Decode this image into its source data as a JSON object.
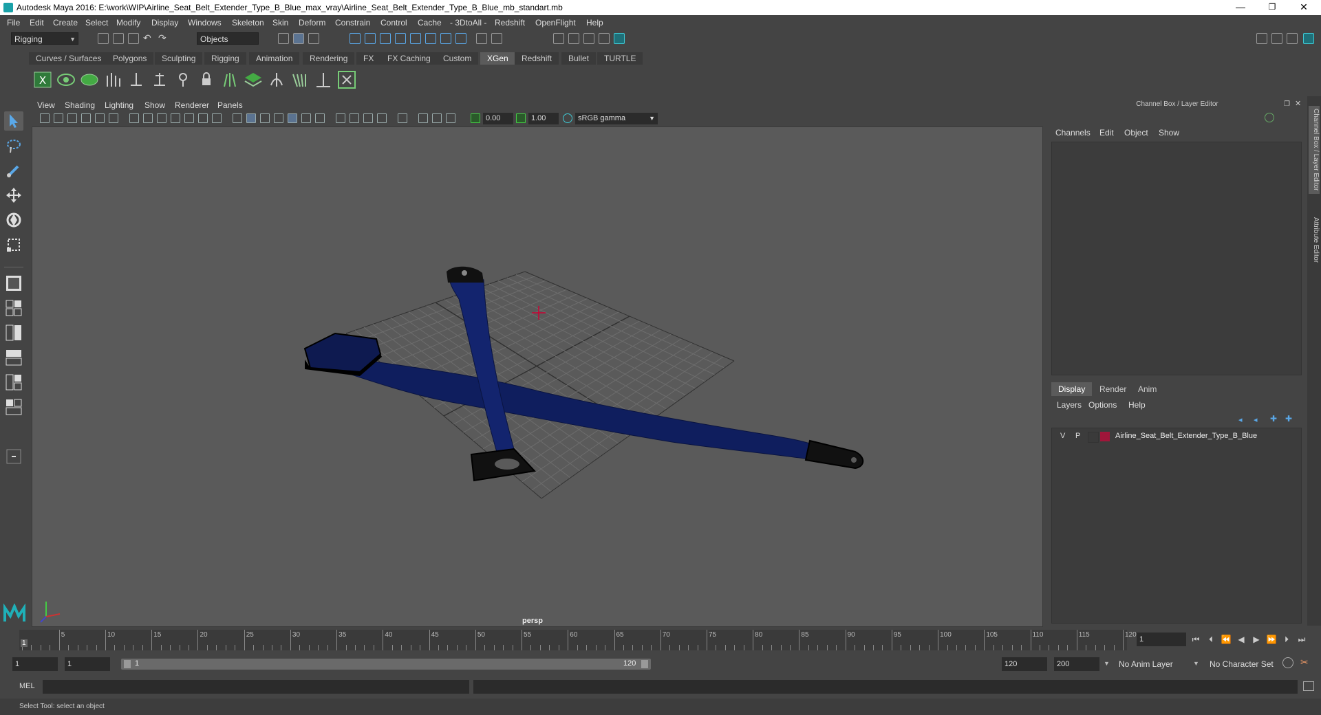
{
  "title_bar": {
    "title": "Autodesk Maya 2016: E:\\work\\WIP\\Airline_Seat_Belt_Extender_Type_B_Blue_max_vray\\Airline_Seat_Belt_Extender_Type_B_Blue_mb_standart.mb",
    "minimize": "—",
    "restore": "❐",
    "close": "✕"
  },
  "menu": [
    "File",
    "Edit",
    "Create",
    "Select",
    "Modify",
    "Display",
    "Windows",
    "Skeleton",
    "Skin",
    "Deform",
    "Constrain",
    "Control",
    "Cache",
    "- 3DtoAll -",
    "Redshift",
    "OpenFlight",
    "Help"
  ],
  "status_line": {
    "mode": "Rigging",
    "selection_mode": "Objects"
  },
  "shelf_tabs": [
    "Curves / Surfaces",
    "Polygons",
    "Sculpting",
    "Rigging",
    "Animation",
    "Rendering",
    "FX",
    "FX Caching",
    "Custom",
    "XGen",
    "Redshift",
    "Bullet",
    "TURTLE"
  ],
  "active_shelf": "XGen",
  "viewport": {
    "menu": [
      "View",
      "Shading",
      "Lighting",
      "Show",
      "Renderer",
      "Panels"
    ],
    "exposure": "0.00",
    "gamma": "1.00",
    "color_space": "sRGB gamma",
    "camera": "persp",
    "colors": {
      "belt": "#0f1e5e",
      "belt_edge": "#0a1440",
      "buckle": "#111111",
      "grid": "#6d6d6d"
    }
  },
  "channel_box": {
    "header": "Channel Box / Layer Editor",
    "menu": [
      "Channels",
      "Edit",
      "Object",
      "Show"
    ],
    "layer_tabs": [
      "Display",
      "Render",
      "Anim"
    ],
    "active_layer_tab": "Display",
    "layer_menu": [
      "Layers",
      "Options",
      "Help"
    ],
    "layers": [
      {
        "v": "V",
        "p": "P",
        "color": "#a0163a",
        "name": "Airline_Seat_Belt_Extender_Type_B_Blue"
      }
    ]
  },
  "side_tabs": [
    "Channel Box / Layer Editor",
    "Attribute Editor"
  ],
  "timeline": {
    "ticks": [
      5,
      10,
      15,
      20,
      25,
      30,
      35,
      40,
      45,
      50,
      55,
      60,
      65,
      70,
      75,
      80,
      85,
      90,
      95,
      100,
      105,
      110,
      115,
      120
    ],
    "current_frame_marker": "1",
    "current_frame": "1"
  },
  "range": {
    "start": "1",
    "playback_start": "1",
    "slider_start": "1",
    "slider_end": "120",
    "playback_end": "120",
    "end": "200",
    "anim_layer": "No Anim Layer",
    "character_set": "No Character Set"
  },
  "command_line": {
    "label": "MEL"
  },
  "help_line": "Select Tool: select an object"
}
